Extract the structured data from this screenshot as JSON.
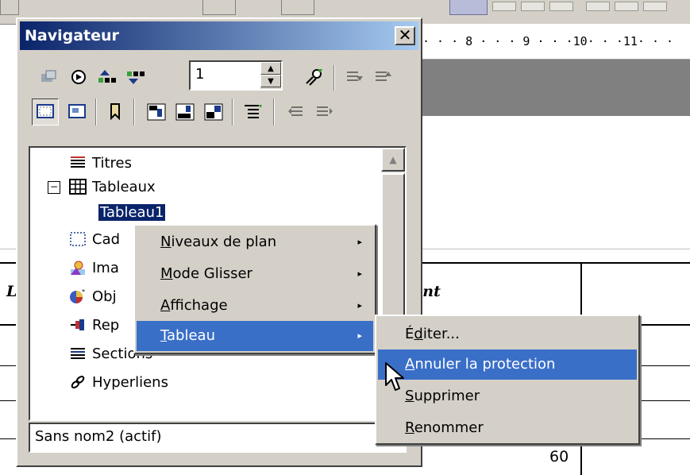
{
  "navigator": {
    "title": "Navigateur",
    "close_symbol": "✕",
    "spin_value": "1",
    "tree": {
      "items": [
        {
          "label": "Titres",
          "icon": "headings-icon"
        },
        {
          "label": "Tableaux",
          "icon": "table-icon",
          "expanded": true
        },
        {
          "label": "Tableau1",
          "icon": "",
          "selected": true
        },
        {
          "label": "Cadres",
          "icon": "frame-icon"
        },
        {
          "label": "Images",
          "icon": "image-icon"
        },
        {
          "label": "Objets OLE",
          "icon": "ole-object-icon"
        },
        {
          "label": "Repères de texte",
          "icon": "bookmark-icon"
        },
        {
          "label": "Sections",
          "icon": "sections-icon"
        },
        {
          "label": "Hyperliens",
          "icon": "hyperlink-icon"
        }
      ],
      "visible": {
        "titres": "Titres",
        "tableaux": "Tableaux",
        "tableau1": "Tableau1",
        "cadres": "Cad",
        "images": "Ima",
        "objets": "Obj",
        "reperes": "Rep",
        "sections": "Sections",
        "hyperliens": "Hyperliens"
      },
      "expander_symbol": "−"
    },
    "document_select": "Sans nom2 (actif)"
  },
  "context_menu": {
    "items": [
      {
        "prefix": "",
        "accel": "N",
        "rest": "iveaux de plan",
        "has_submenu": true
      },
      {
        "prefix": "",
        "accel": "M",
        "rest": "ode Glisser",
        "has_submenu": true
      },
      {
        "prefix": "",
        "accel": "A",
        "rest": "ffichage",
        "has_submenu": true
      },
      {
        "prefix": "",
        "accel": "T",
        "rest": "ableau",
        "has_submenu": true,
        "highlighted": true
      }
    ],
    "submenu_arrow": "▸"
  },
  "submenu": {
    "items": [
      {
        "prefix": "É",
        "accel": "d",
        "rest": "iter..."
      },
      {
        "prefix": "",
        "accel": "A",
        "rest": "nnuler la protection",
        "highlighted": true
      },
      {
        "prefix": "",
        "accel": "S",
        "rest": "upprimer"
      },
      {
        "prefix": "",
        "accel": "R",
        "rest": "enommer"
      }
    ]
  },
  "document": {
    "ruler_text": "· · · 8 · · · 9 · · ·10· · ·11· · ·",
    "cell_text_partial": "ant",
    "left_partial": "L",
    "cell_number": "60"
  },
  "colors": {
    "menu_highlight": "#0a246a",
    "submenu_highlight": "#3a6fc8",
    "face": "#d4d0c8"
  }
}
